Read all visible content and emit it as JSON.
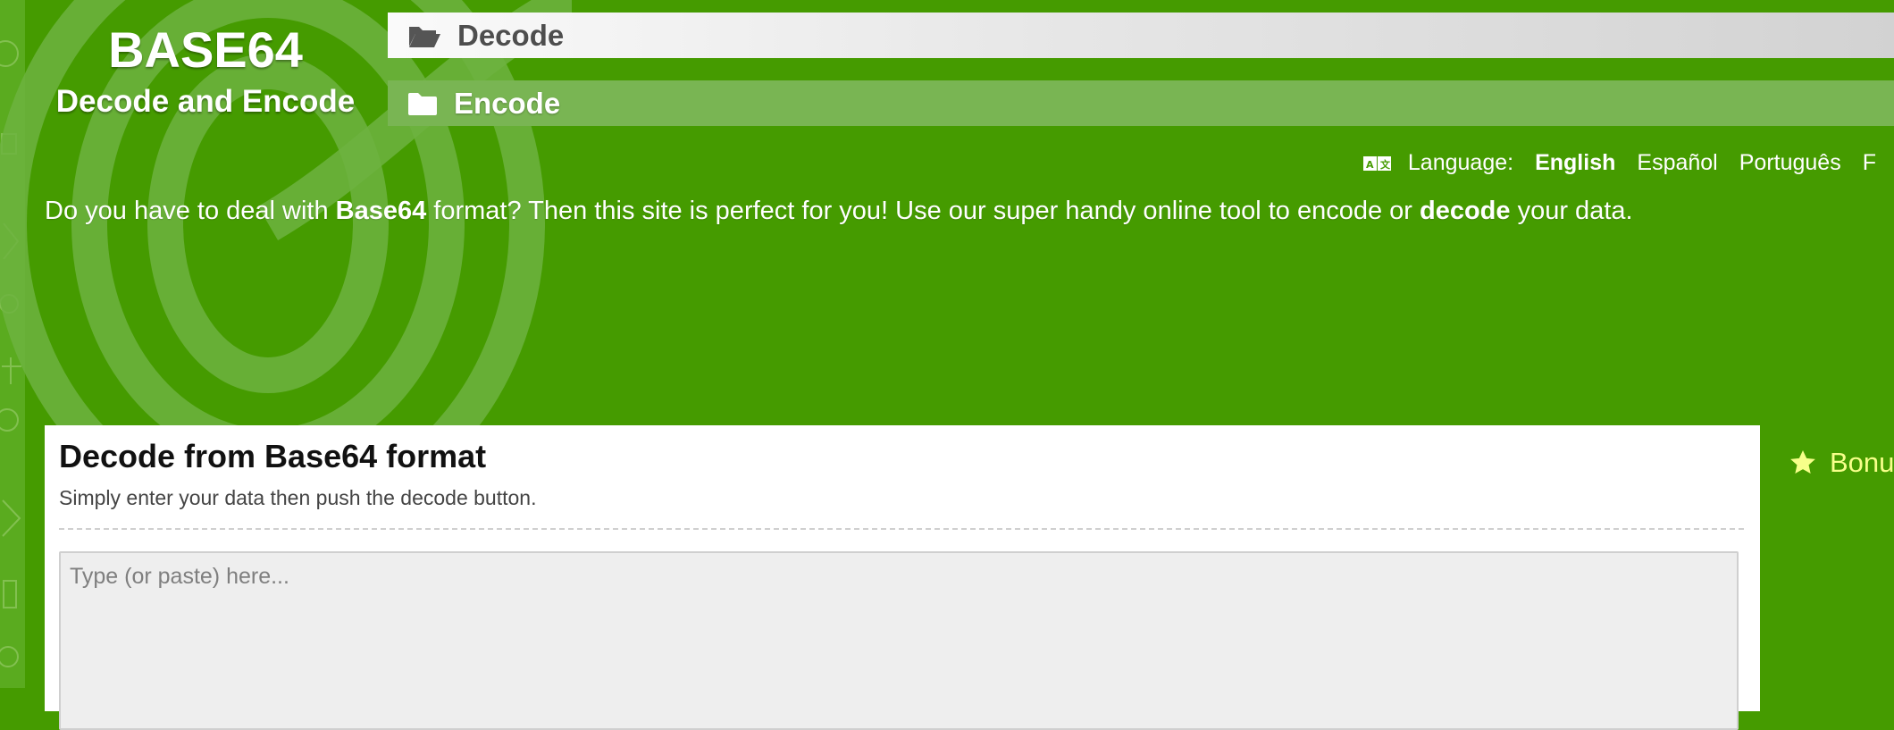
{
  "brand": {
    "title": "BASE64",
    "subtitle": "Decode and Encode"
  },
  "nav": {
    "tabs": [
      {
        "label": "Decode",
        "icon": "folder-open-icon",
        "active": true
      },
      {
        "label": "Encode",
        "icon": "folder-icon",
        "active": false
      }
    ]
  },
  "language": {
    "icon": "language-icon",
    "label": "Language:",
    "options": [
      "English",
      "Español",
      "Português",
      "F"
    ],
    "selected": "English"
  },
  "intro": {
    "part1": "Do you have to deal with ",
    "bold1": "Base64",
    "part2": " format? Then this site is perfect for you! Use our super handy online tool to encode or ",
    "bold2": "decode",
    "part3": " your data."
  },
  "decode_panel": {
    "title": "Decode from Base64 format",
    "subtitle": "Simply enter your data then push the decode button.",
    "input_placeholder": "Type (or paste) here...",
    "input_value": ""
  },
  "sidebar": {
    "bonus_label": "Bonu",
    "bonus_icon": "star-icon"
  },
  "colors": {
    "background": "#459b00",
    "accent_text": "#f7ff8a",
    "tab_inactive": "#79b553"
  }
}
